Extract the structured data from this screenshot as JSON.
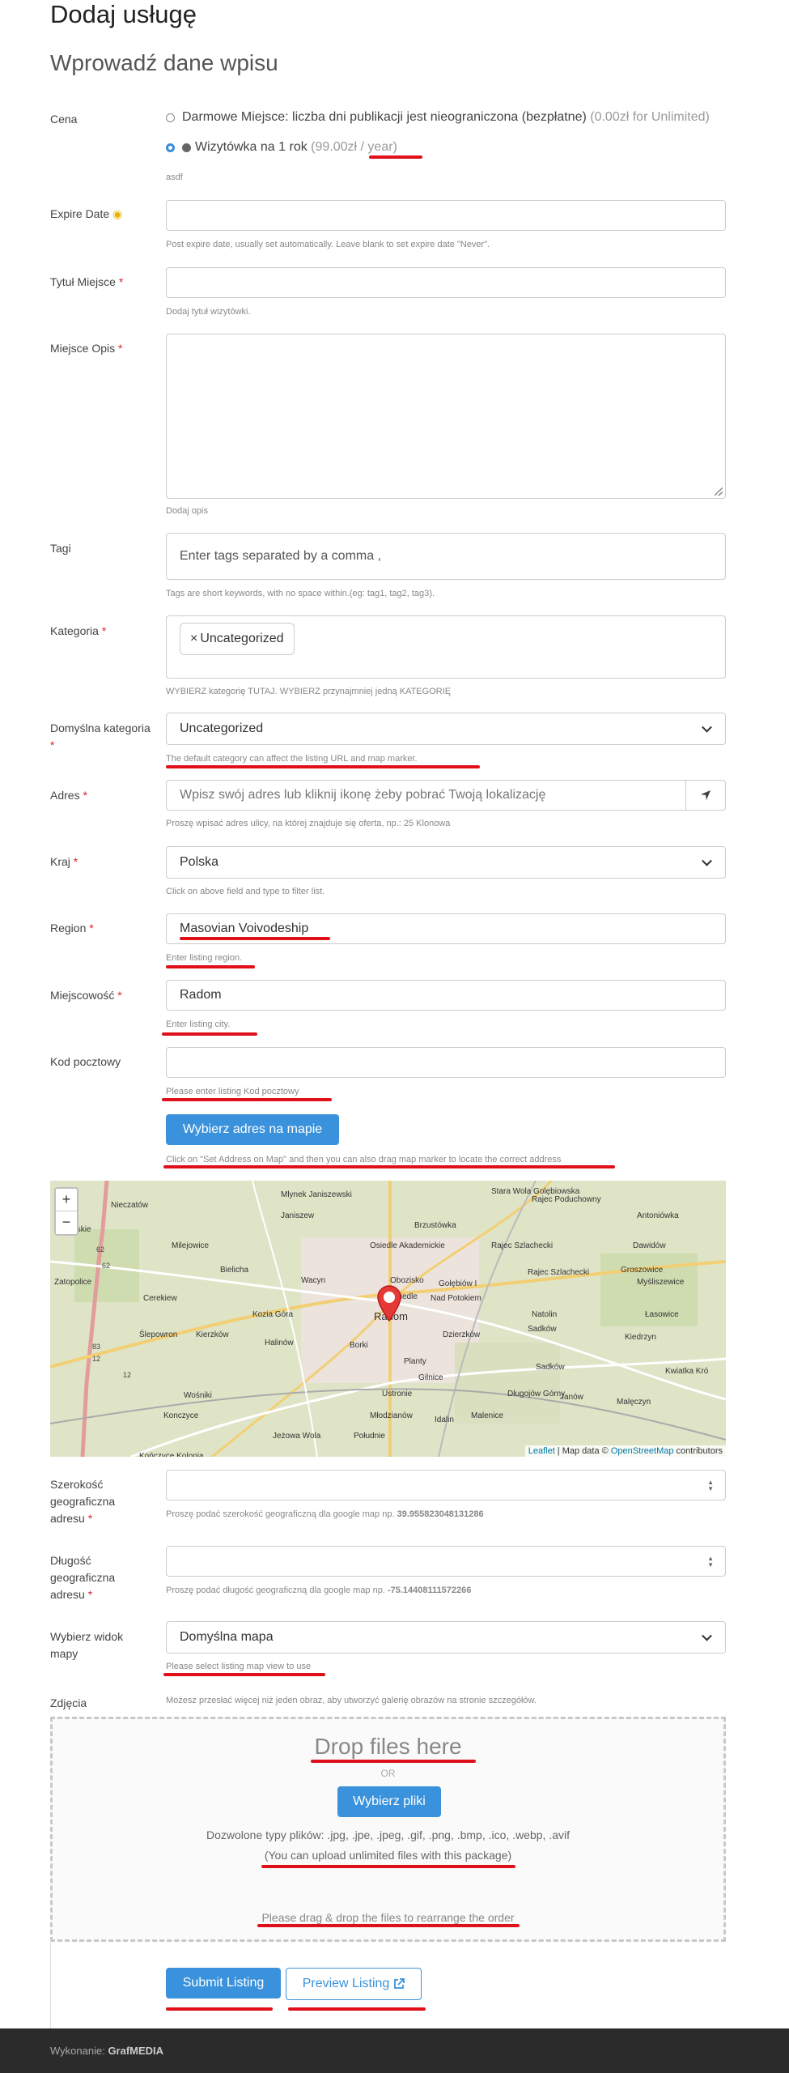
{
  "page": {
    "title": "Dodaj usługę",
    "subtitle": "Wprowadź dane wpisu"
  },
  "price": {
    "label": "Cena",
    "option1_main": "Darmowe Miejsce: liczba dni publikacji jest nieograniczona (bezpłatne)",
    "option1_price": "(0.00zł for Unlimited)",
    "option2_main": "Wizytówka na 1 rok",
    "option2_price": "(99.00zł / year)",
    "note": "asdf"
  },
  "expire": {
    "label": "Expire Date",
    "help": "Post expire date, usually set automatically. Leave blank to set expire date \"Never\"."
  },
  "title_field": {
    "label": "Tytuł Miejsce",
    "help": "Dodaj tytuł wizytówki."
  },
  "description": {
    "label": "Miejsce Opis",
    "help": "Dodaj opis"
  },
  "tags": {
    "label": "Tagi",
    "placeholder": "Enter tags separated by a comma ,",
    "help": "Tags are short keywords, with no space within.(eg: tag1, tag2, tag3)."
  },
  "category": {
    "label": "Kategoria",
    "chip": "Uncategorized",
    "chip_x": "×",
    "help": "WYBIERZ kategorię TUTAJ. WYBIERZ przynajmniej jedną KATEGORIĘ"
  },
  "default_category": {
    "label": "Domyślna kategoria",
    "value": "Uncategorized",
    "help": "The default category can affect the listing URL and map marker."
  },
  "address": {
    "label": "Adres",
    "placeholder": "Wpisz swój adres lub kliknij ikonę żeby pobrać Twoją lokalizację",
    "help": "Proszę wpisać adres ulicy, na której znajduje się oferta, np.: 25 Klonowa"
  },
  "country": {
    "label": "Kraj",
    "value": "Polska",
    "help": "Click on above field and type to filter list."
  },
  "region": {
    "label": "Region",
    "value": "Masovian Voivodeship",
    "help": "Enter listing region."
  },
  "city": {
    "label": "Miejscowość",
    "value": "Radom",
    "help": "Enter listing city."
  },
  "postal": {
    "label": "Kod pocztowy",
    "help": "Please enter listing Kod pocztowy"
  },
  "map_button": {
    "label": "Wybierz adres na mapie",
    "help": "Click on \"Set Address on Map\" and then you can also drag map marker to locate the correct address"
  },
  "map": {
    "zoom_in": "+",
    "zoom_out": "−",
    "attribution_leaflet": "Leaflet",
    "attribution_mid": " | Map data © ",
    "attribution_osm": "OpenStreetMap",
    "attribution_end": " contributors",
    "places": [
      "Mlynek Janiszewski",
      "Stara Wola Golębiowska",
      "Rajec Poduchowny",
      "Nieczatów",
      "Janiszew",
      "Brzustówka",
      "Antoniówka",
      "Krzewskie",
      "Milejowice",
      "Osiedle Akademickie",
      "Rajec Szlachecki",
      "Dawidów",
      "Bielicha",
      "Groszowice",
      "Zatopolice",
      "Cerekiew",
      "Wacyn",
      "Obozisko",
      "Gołębiów I",
      "Rajec Szlachecki",
      "Myśliszewice",
      "Osiedle",
      "Nad Potokiem",
      "Kozia Góra",
      "Radom",
      "Natolin",
      "Łasowice",
      "Ślepowron",
      "Kierzków",
      "Dzierzków",
      "Sadków",
      "Kiedrzyn",
      "Halinów",
      "Borki",
      "Planty",
      "Sadków",
      "Kwiatka Kró",
      "Gilnice",
      "Wośniki",
      "Ustronie",
      "Długojów Górny",
      "Janów",
      "Malęczyn",
      "Konczyce",
      "Młodzianów",
      "Idalin",
      "Malenice",
      "Jeżowa Wola",
      "Południe",
      "Kończyce Kolonia"
    ],
    "roads": [
      "62",
      "62",
      "83",
      "12",
      "12"
    ]
  },
  "lat": {
    "label": "Szerokość geograficzna adresu",
    "help": "Proszę podać szerokość geograficzną dla google map np.",
    "example": "39.955823048131286"
  },
  "lng": {
    "label": "Długość geograficzna adresu",
    "help": "Proszę podać długość geograficzną dla google map np.",
    "example": "-75.14408111572266"
  },
  "map_view": {
    "label": "Wybierz widok mapy",
    "value": "Domyślna mapa",
    "help": "Please select listing map view to use"
  },
  "photos": {
    "label": "Zdjęcia",
    "help": "Możesz przesłać więcej niż jeden obraz, aby utworzyć galerię obrazów na stronie szczegółów.",
    "drop_title": "Drop files here",
    "or": "OR",
    "choose": "Wybierz pliki",
    "types": "Dozwolone typy plików: .jpg, .jpe, .jpeg, .gif, .png, .bmp, .ico, .webp, .avif",
    "unlimited": "(You can upload unlimited files with this package)",
    "drag": "Please drag & drop the files to rearrange the order"
  },
  "actions": {
    "submit": "Submit Listing",
    "preview": "Preview Listing"
  },
  "footer": {
    "prefix": "Wykonanie:",
    "brand": "GrafMEDIA"
  },
  "colors": {
    "accent": "#3a92dc",
    "annotation": "#e0101a",
    "required": "#d9232d",
    "footer_bg": "#2b2b2b",
    "marker": "#e53935"
  }
}
